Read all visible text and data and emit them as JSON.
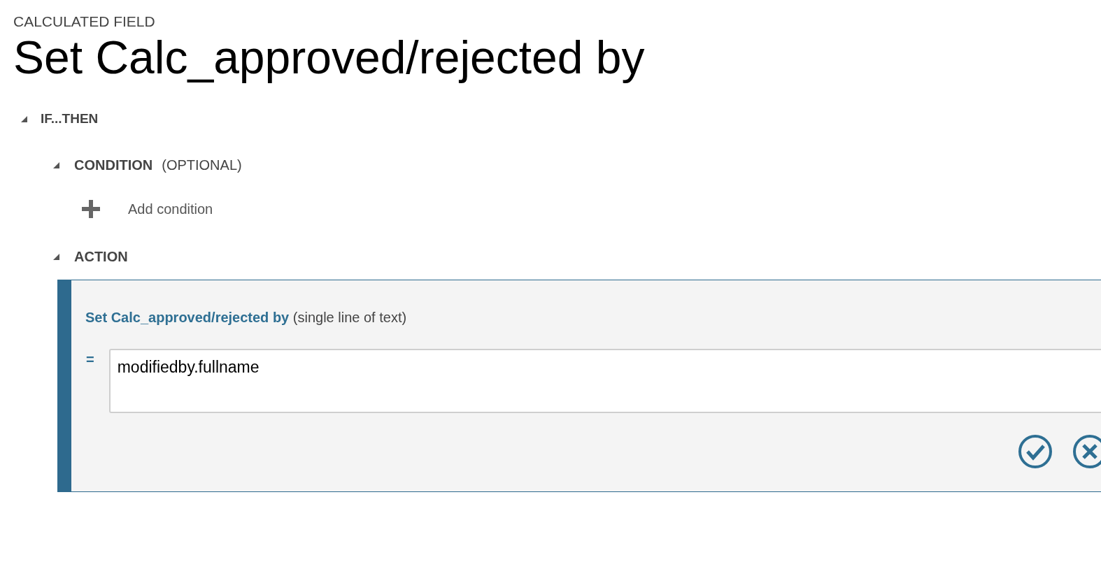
{
  "header": {
    "kicker": "CALCULATED FIELD",
    "title": "Set Calc_approved/rejected by"
  },
  "block": {
    "label": "IF...THEN",
    "expanded": true
  },
  "condition": {
    "label": "CONDITION",
    "note": "(OPTIONAL)",
    "expanded": true,
    "add_label": "Add condition"
  },
  "action": {
    "label": "ACTION",
    "expanded": true,
    "field_name": "Set Calc_approved/rejected by",
    "field_type": "(single line of text)",
    "operator": "=",
    "value": "modifiedby.fullname"
  }
}
